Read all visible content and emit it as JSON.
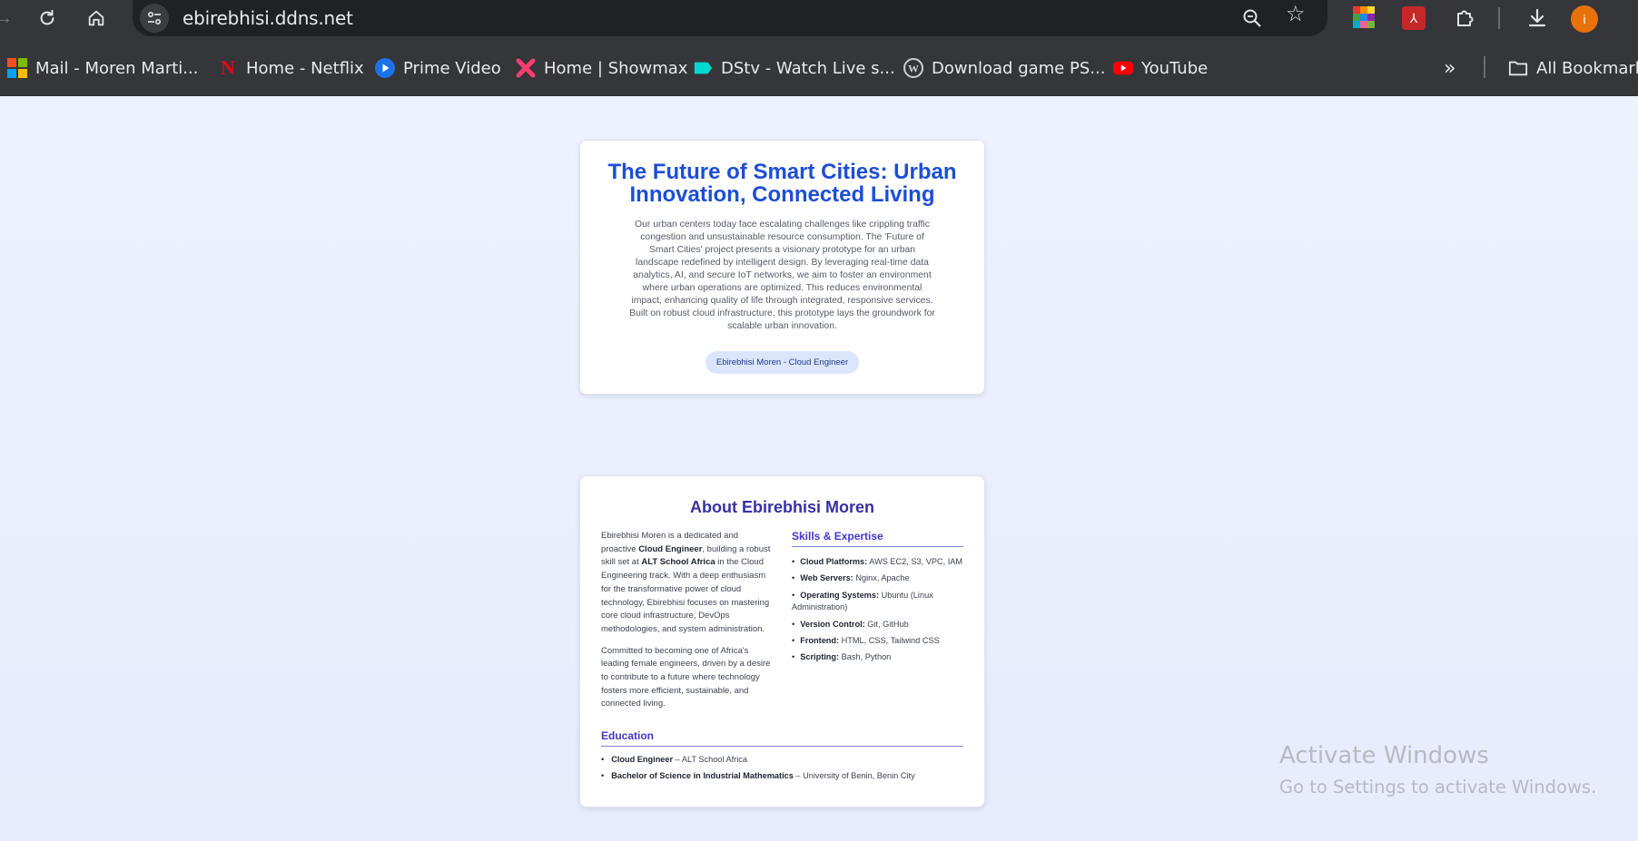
{
  "browser": {
    "url": "ebirebhisi.ddns.net",
    "avatar_letter": "i",
    "bookmarks": [
      {
        "label": "Mail - Moren Marti...",
        "icon": "microsoft-icon"
      },
      {
        "label": "Home - Netflix",
        "icon": "netflix-icon"
      },
      {
        "label": "Prime Video",
        "icon": "prime-video-icon"
      },
      {
        "label": "Home | Showmax",
        "icon": "showmax-icon"
      },
      {
        "label": "DStv - Watch Live s...",
        "icon": "dstv-icon"
      },
      {
        "label": "Download game PS...",
        "icon": "wordpress-icon"
      },
      {
        "label": "YouTube",
        "icon": "youtube-icon"
      }
    ],
    "all_bookmarks_label": "All Bookmarks"
  },
  "hero": {
    "title": "The Future of Smart Cities: Urban Innovation, Connected Living",
    "description": "Our urban centers today face escalating challenges like crippling traffic congestion and unsustainable resource consumption. The 'Future of Smart Cities' project presents a visionary prototype for an urban landscape redefined by intelligent design. By leveraging real-time data analytics, AI, and secure IoT networks, we aim to foster an environment where urban operations are optimized. This reduces environmental impact, enhancing quality of life through integrated, responsive services. Built on robust cloud infrastructure, this prototype lays the groundwork for scalable urban innovation.",
    "author_badge": "Ebirebhisi Moren - Cloud Engineer"
  },
  "about": {
    "heading": "About Ebirebhisi Moren",
    "bio1": {
      "t1": "Ebirebhisi Moren is a dedicated and proactive ",
      "b1": "Cloud Engineer",
      "t2": ", building a robust skill set at ",
      "b2": "ALT School Africa",
      "t3": " in the Cloud Engineering track. With a deep enthusiasm for the transformative power of cloud technology, Ebirebhisi focuses on mastering core cloud infrastructure, DevOps methodologies, and system administration."
    },
    "bio2": "Committed to becoming one of Africa's leading female engineers, driven by a desire to contribute to a future where technology fosters more efficient, sustainable, and connected living.",
    "skills_heading": "Skills & Expertise",
    "skills": [
      {
        "label": "Cloud Platforms:",
        "value": " AWS EC2, S3, VPC, IAM"
      },
      {
        "label": "Web Servers:",
        "value": " Nginx, Apache"
      },
      {
        "label": "Operating Systems:",
        "value": " Ubuntu (Linux Administration)"
      },
      {
        "label": "Version Control:",
        "value": " Git, GitHub"
      },
      {
        "label": "Frontend:",
        "value": " HTML, CSS, Tailwind CSS"
      },
      {
        "label": "Scripting:",
        "value": " Bash, Python"
      }
    ],
    "education_heading": "Education",
    "education": [
      {
        "degree": "Cloud Engineer",
        "school": " – ALT School Africa"
      },
      {
        "degree": "Bachelor of Science in Industrial Mathematics",
        "school": " – University of Benin, Benin City"
      }
    ]
  },
  "watermark": {
    "line1": "Activate Windows",
    "line2": "Go to Settings to activate Windows."
  }
}
